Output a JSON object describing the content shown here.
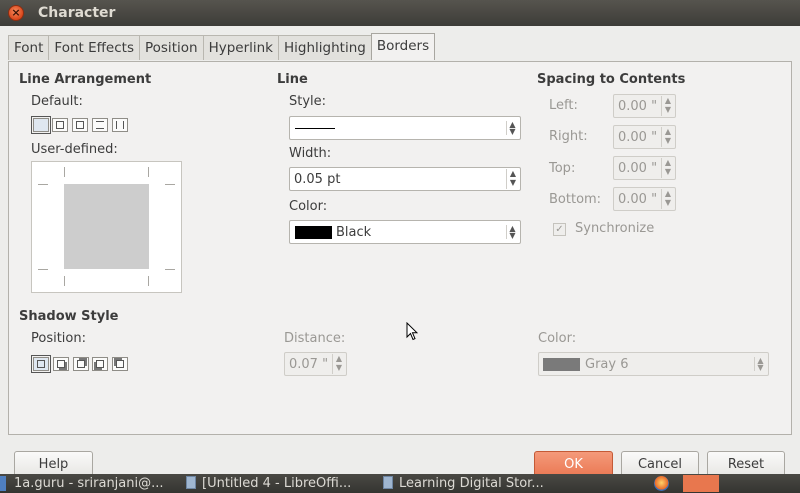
{
  "window": {
    "title": "Character"
  },
  "tabs": [
    "Font",
    "Font Effects",
    "Position",
    "Hyperlink",
    "Highlighting",
    "Borders"
  ],
  "active_tab": "Borders",
  "line_arrangement": {
    "title": "Line Arrangement",
    "default_label": "Default:",
    "user_defined_label": "User-defined:"
  },
  "line": {
    "title": "Line",
    "style_label": "Style:",
    "width_label": "Width:",
    "width_value": "0.05 pt",
    "color_label": "Color:",
    "color_value": "Black",
    "color_swatch": "#000000"
  },
  "spacing": {
    "title": "Spacing to Contents",
    "left_label": "Left:",
    "left_value": "0.00 \"",
    "right_label": "Right:",
    "right_value": "0.00 \"",
    "top_label": "Top:",
    "top_value": "0.00 \"",
    "bottom_label": "Bottom:",
    "bottom_value": "0.00 \"",
    "sync_label": "Synchronize"
  },
  "shadow": {
    "title": "Shadow Style",
    "position_label": "Position:",
    "distance_label": "Distance:",
    "distance_value": "0.07 \"",
    "color_label": "Color:",
    "color_value": "Gray 6",
    "color_swatch": "#7a7a7a"
  },
  "buttons": {
    "help": "Help",
    "ok": "OK",
    "cancel": "Cancel",
    "reset": "Reset"
  },
  "taskbar": {
    "items": [
      "1a.guru - sriranjani@...",
      "[Untitled 4 - LibreOffi...",
      "Learning Digital Stor..."
    ]
  }
}
